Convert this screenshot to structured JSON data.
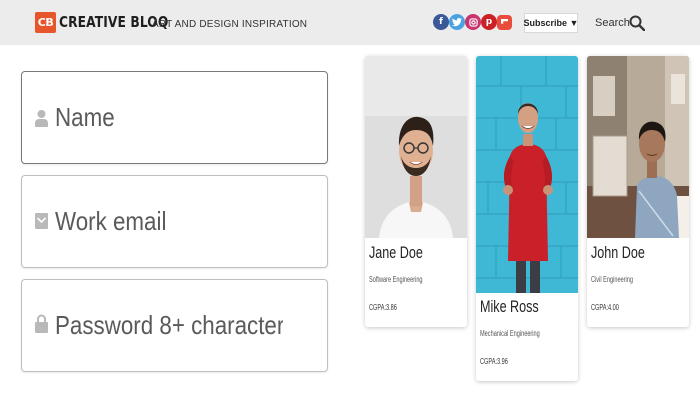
{
  "header": {
    "logo_badge": "CB",
    "logo_text": "CREATIVE BLOQ",
    "tagline": "ART AND DESIGN INSPIRATION",
    "socials": [
      {
        "name": "facebook",
        "glyph": "f",
        "color": "#3b5998"
      },
      {
        "name": "twitter",
        "glyph": "t",
        "color": "#4aa3e0"
      },
      {
        "name": "instagram",
        "glyph": "◎",
        "color": "#c7356f"
      },
      {
        "name": "pinterest",
        "glyph": "p",
        "color": "#cc2027"
      },
      {
        "name": "flipboard",
        "glyph": "F",
        "color": "#e94b3c"
      }
    ],
    "subscribe_label": "Subscribe ▼",
    "search_label": "Search"
  },
  "form": {
    "name_placeholder": "Name",
    "email_placeholder": "Work email",
    "password_placeholder": "Password 8+ characters"
  },
  "cards": [
    {
      "name": "Jane Doe",
      "department": "Software Engineering",
      "gpa": "CGPA:3.86"
    },
    {
      "name": "Mike Ross",
      "department": "Mechanical Engineering",
      "gpa": "CGPA:3.96"
    },
    {
      "name": "John Doe",
      "department": "Civil Engineering",
      "gpa": "CGPA:4.00"
    }
  ],
  "colors": {
    "header_bg": "#ececec",
    "brand_accent": "#e8542c",
    "photo_wall_blue": "#3fb8d6",
    "shirt_red": "#c9202a"
  }
}
